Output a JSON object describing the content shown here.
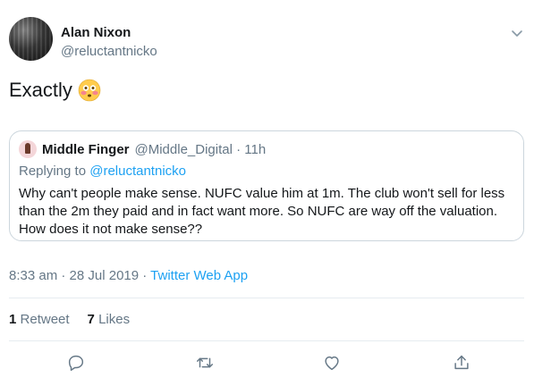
{
  "tweet": {
    "author_name": "Alan Nixon",
    "author_handle": "@reluctantnicko",
    "text": "Exactly",
    "emoji": "flushed-face-emoji",
    "timestamp": "8:33 am · 28 Jul 2019 · ",
    "source": "Twitter Web App"
  },
  "quote": {
    "author_name": "Middle Finger",
    "meta": "@Middle_Digital · 11h",
    "replying_prefix": "Replying to ",
    "replying_to": "@reluctantnicko",
    "body": "Why can't people make sense. NUFC value him at 1m. The club won't sell for less than the 2m they paid and in fact want more. So NUFC are way off the valuation. How does it not make sense??"
  },
  "stats": {
    "retweets_count": "1",
    "retweets_label": "Retweet",
    "likes_count": "7",
    "likes_label": "Likes"
  },
  "actions": [
    "reply-icon",
    "retweet-icon",
    "like-icon",
    "share-icon"
  ],
  "colors": {
    "link": "#1da1f2",
    "secondary_text": "#657786",
    "border": "#ccd6dd"
  }
}
